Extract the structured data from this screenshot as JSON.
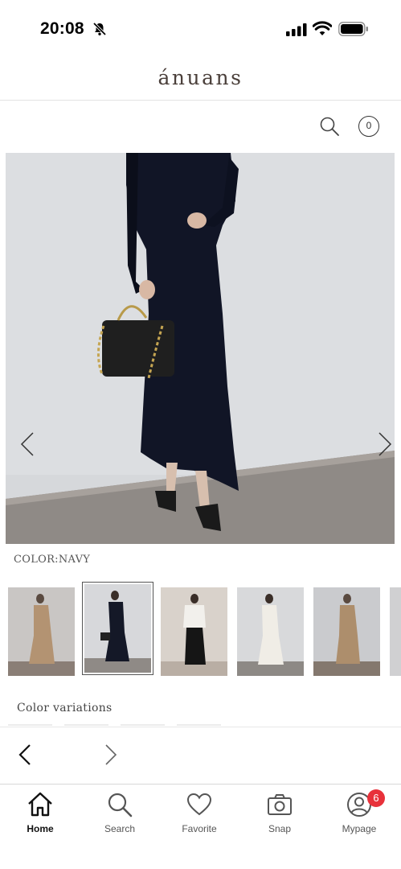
{
  "status_bar": {
    "time": "20:08",
    "icons": [
      "bell-off-icon",
      "cellular-signal-icon",
      "wifi-icon",
      "battery-icon"
    ]
  },
  "header": {
    "brand": "ánuans"
  },
  "toolbar": {
    "search_icon": "search-icon",
    "cart_count": "0"
  },
  "product": {
    "image_icons": [
      "chevron-left-icon",
      "chevron-right-icon"
    ],
    "color_label": "COLOR:NAVY",
    "thumbnails": [
      {
        "color": "beige",
        "selected": false
      },
      {
        "color": "navy",
        "selected": true
      },
      {
        "color": "black-white",
        "selected": false
      },
      {
        "color": "white",
        "selected": false
      },
      {
        "color": "beige",
        "selected": false
      }
    ],
    "variations_title": "Color variations"
  },
  "pager": {
    "icons": [
      "chevron-left-icon",
      "chevron-right-icon"
    ]
  },
  "tab_bar": {
    "tabs": [
      {
        "label": "Home",
        "icon": "home-icon",
        "active": true
      },
      {
        "label": "Search",
        "icon": "search-icon",
        "active": false
      },
      {
        "label": "Favorite",
        "icon": "heart-icon",
        "active": false
      },
      {
        "label": "Snap",
        "icon": "camera-icon",
        "active": false
      },
      {
        "label": "Mypage",
        "icon": "user-icon",
        "active": false,
        "badge": "6"
      }
    ]
  },
  "colors": {
    "accent_badge": "#e8313a",
    "brand_text": "#4a3f3a"
  }
}
